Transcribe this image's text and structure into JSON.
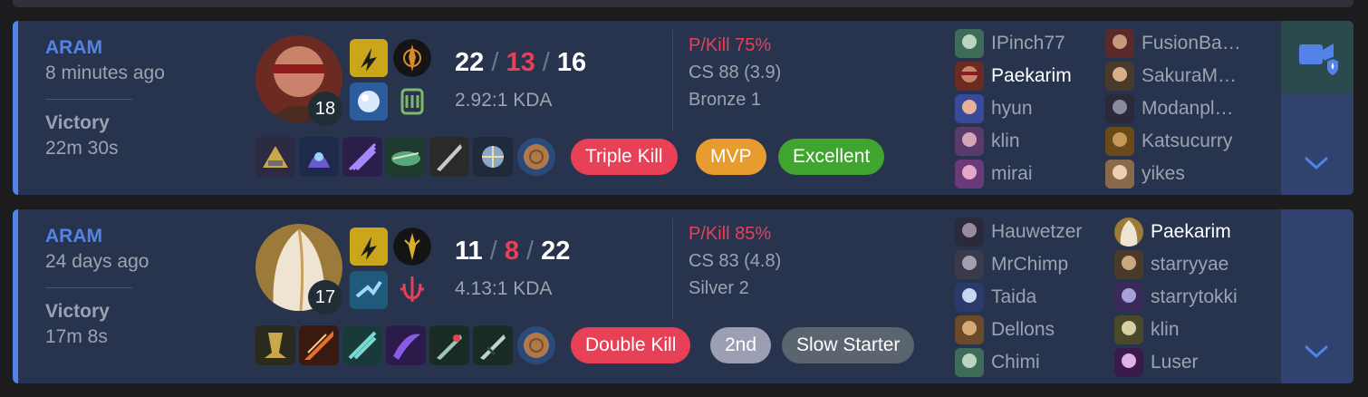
{
  "matches": [
    {
      "mode": "ARAM",
      "time_ago": "8 minutes ago",
      "result": "Victory",
      "duration": "22m 30s",
      "champion_level": "18",
      "kills": "22",
      "deaths": "13",
      "assists": "16",
      "kda_ratio": "2.92:1 KDA",
      "pkill": "P/Kill 75%",
      "cs": "CS 88 (3.9)",
      "rank": "Bronze 1",
      "badges": [
        "Triple Kill",
        "MVP",
        "Excellent"
      ],
      "players_left": [
        "IPinch77",
        "Paekarim",
        "hyun",
        "klin",
        "mirai"
      ],
      "players_right": [
        "FusionBa…",
        "SakuraM…",
        "Modanpl…",
        "Katsucurry",
        "yikes"
      ]
    },
    {
      "mode": "ARAM",
      "time_ago": "24 days ago",
      "result": "Victory",
      "duration": "17m 8s",
      "champion_level": "17",
      "kills": "11",
      "deaths": "8",
      "assists": "22",
      "kda_ratio": "4.13:1 KDA",
      "pkill": "P/Kill 85%",
      "cs": "CS 83 (4.8)",
      "rank": "Silver 2",
      "badges": [
        "Double Kill",
        "2nd",
        "Slow Starter"
      ],
      "players_left": [
        "Hauwetzer",
        "MrChimp",
        "Taida",
        "Dellons",
        "Chimi"
      ],
      "players_right": [
        "Paekarim",
        "starryyae",
        "starrytokki",
        "klin",
        "Luser"
      ]
    }
  ],
  "colors": {
    "victory_accent": "#5383e8",
    "deaths": "#e84057",
    "badge_triple_kill": "#e84057",
    "badge_mvp": "#e89c2f",
    "badge_excellent": "#3fa52f",
    "badge_double_kill": "#e84057",
    "badge_2nd": "#9c9fb4",
    "badge_slow_starter": "#5a6570"
  },
  "icons": {
    "video": "video-camera-icon",
    "expand": "chevron-down-icon"
  }
}
